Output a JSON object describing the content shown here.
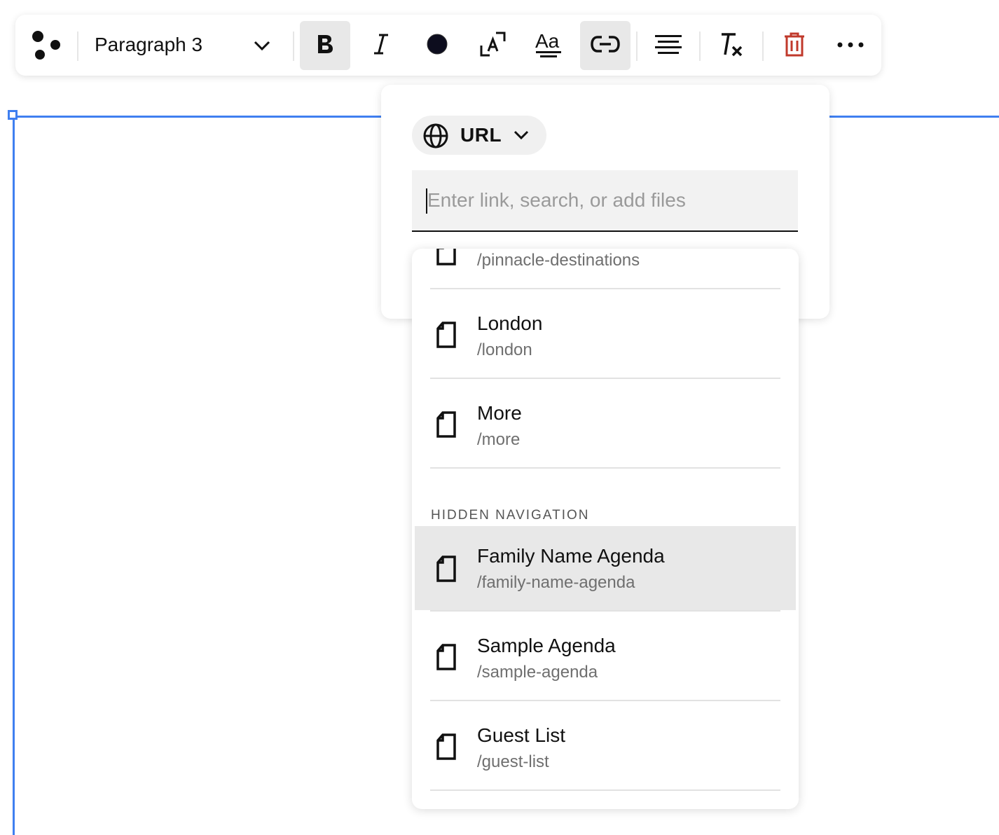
{
  "toolbar": {
    "logo_icon": "three-dots-logo-icon",
    "style_select": {
      "value": "Paragraph 3",
      "icon": "chevron-down-icon"
    },
    "buttons": [
      {
        "name": "bold",
        "icon": "bold-icon",
        "active": true
      },
      {
        "name": "italic",
        "icon": "italic-icon",
        "active": false
      },
      {
        "name": "text-color",
        "icon": "color-swatch-icon",
        "color": "#0d0d1e"
      },
      {
        "name": "text-size",
        "icon": "text-size-icon",
        "active": false
      },
      {
        "name": "font",
        "icon": "font-style-icon",
        "active": false
      },
      {
        "name": "link",
        "icon": "link-icon",
        "active": true
      },
      {
        "name": "align",
        "icon": "align-icon",
        "active": false
      },
      {
        "name": "clear-format",
        "icon": "clear-format-icon",
        "active": false
      },
      {
        "name": "delete",
        "icon": "trash-icon",
        "color": "#c0392b"
      },
      {
        "name": "more",
        "icon": "more-horizontal-icon"
      }
    ]
  },
  "link_popover": {
    "type_selector": {
      "label": "URL",
      "icon": "globe-icon",
      "chevron": "chevron-down-icon"
    },
    "input": {
      "value": "",
      "placeholder": "Enter link, search, or add files"
    }
  },
  "results": {
    "items_top": [
      {
        "title": "",
        "slug": "/pinnacle-destinations"
      },
      {
        "title": "London",
        "slug": "/london"
      },
      {
        "title": "More",
        "slug": "/more"
      }
    ],
    "hidden_header": "HIDDEN NAVIGATION",
    "items_hidden": [
      {
        "title": "Family Name Agenda",
        "slug": "/family-name-agenda",
        "highlighted": true
      },
      {
        "title": "Sample Agenda",
        "slug": "/sample-agenda"
      },
      {
        "title": "Guest List",
        "slug": "/guest-list"
      }
    ]
  },
  "colors": {
    "accent": "#3f7ff0",
    "highlight": "#e8e8e8",
    "danger": "#c0392b"
  }
}
